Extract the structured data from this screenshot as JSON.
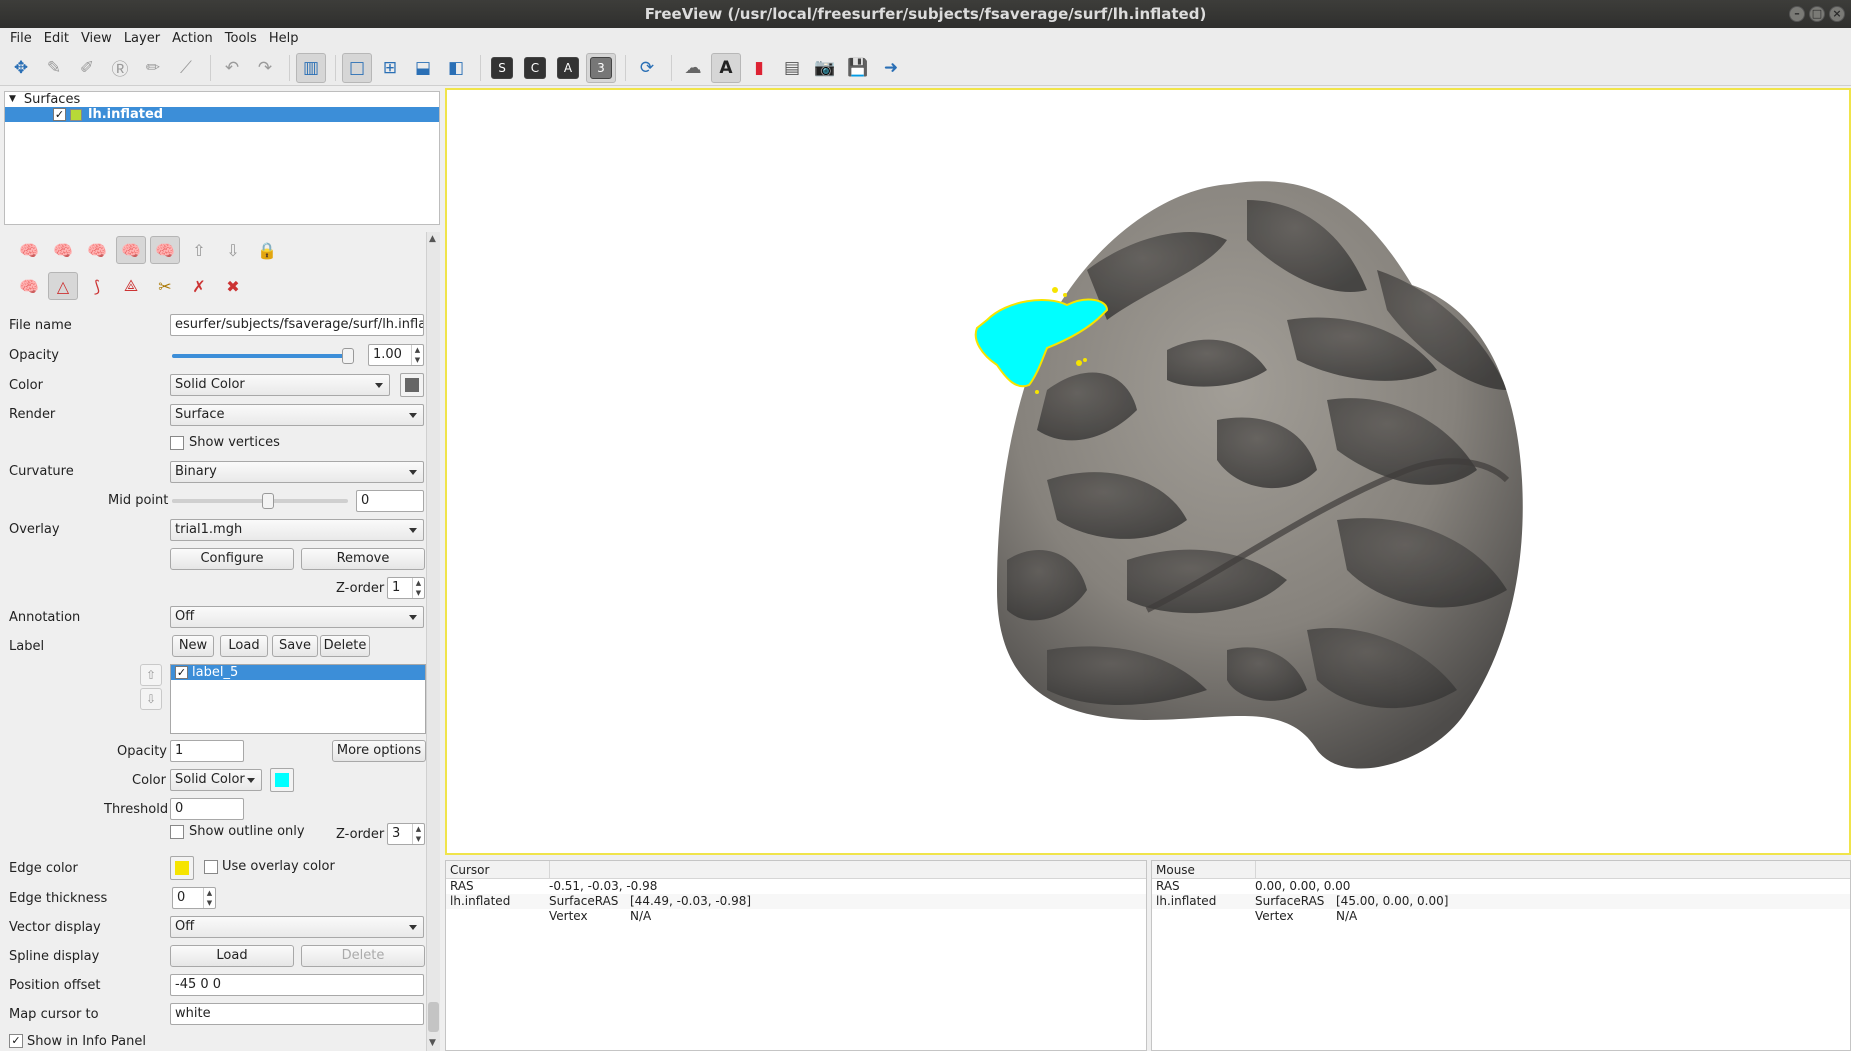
{
  "window": {
    "title": "FreeView (/usr/local/freesurfer/subjects/fsaverage/surf/lh.inflated)"
  },
  "menu": [
    "File",
    "Edit",
    "View",
    "Layer",
    "Action",
    "Tools",
    "Help"
  ],
  "layers": {
    "group": "Surfaces",
    "items": [
      {
        "name": "lh.inflated",
        "checked": true,
        "color": "#b7d937"
      }
    ]
  },
  "props": {
    "file_name_label": "File name",
    "file_name_value": "esurfer/subjects/fsaverage/surf/lh.inflated",
    "opacity_label": "Opacity",
    "opacity_value": "1.00",
    "opacity_level": 1.0,
    "color_label": "Color",
    "color_value": "Solid Color",
    "render_label": "Render",
    "render_value": "Surface",
    "show_vertices_label": "Show vertices",
    "curvature_label": "Curvature",
    "curvature_value": "Binary",
    "mid_point_label": "Mid point",
    "mid_point_value": "0",
    "mid_point_level": 0.55,
    "overlay_label": "Overlay",
    "overlay_value": "trial1.mgh",
    "configure_label": "Configure",
    "remove_label": "Remove",
    "zorder_label": "Z-order",
    "overlay_zorder": "1",
    "annotation_label": "Annotation",
    "annotation_value": "Off",
    "label_label": "Label",
    "new_label": "New",
    "load_label": "Load",
    "save_label": "Save",
    "delete_label": "Delete",
    "label_list": [
      {
        "name": "label_5",
        "checked": true
      }
    ],
    "label_opacity_label": "Opacity",
    "label_opacity_value": "1",
    "more_options_label": "More options",
    "label_color_label": "Color",
    "label_color_value": "Solid Color",
    "label_color_swatch": "#00ffff",
    "threshold_label": "Threshold",
    "threshold_value": "0",
    "show_outline_label": "Show outline only",
    "label_zorder": "3",
    "edge_color_label": "Edge color",
    "edge_color_swatch": "#f6e400",
    "use_overlay_color_label": "Use overlay color",
    "edge_thickness_label": "Edge thickness",
    "edge_thickness_value": "0",
    "vector_display_label": "Vector display",
    "vector_display_value": "Off",
    "spline_display_label": "Spline display",
    "spline_load_label": "Load",
    "spline_delete_label": "Delete",
    "position_offset_label": "Position offset",
    "position_offset_value": "-45 0 0",
    "map_cursor_label": "Map cursor to",
    "map_cursor_value": "white",
    "show_info_label": "Show in Info Panel"
  },
  "cursor_panel": {
    "title": "Cursor",
    "rows": [
      {
        "c1": "RAS",
        "c2": "-0.51, -0.03, -0.98",
        "c3": ""
      },
      {
        "c1": "lh.inflated",
        "c2": "SurfaceRAS",
        "c3": "[44.49, -0.03, -0.98]"
      },
      {
        "c1": "",
        "c2": "Vertex",
        "c3": "N/A"
      }
    ]
  },
  "mouse_panel": {
    "title": "Mouse",
    "rows": [
      {
        "c1": "RAS",
        "c2": "0.00, 0.00, 0.00",
        "c3": ""
      },
      {
        "c1": "lh.inflated",
        "c2": "SurfaceRAS",
        "c3": "[45.00, 0.00, 0.00]"
      },
      {
        "c1": "",
        "c2": "Vertex",
        "c3": "N/A"
      }
    ]
  },
  "colors": {
    "label_fill": "#00ffff",
    "label_edge": "#f6e400",
    "surface_light": "#8f8b85",
    "surface_dark": "#4f4d4b",
    "view_border": "#f0e44a"
  }
}
